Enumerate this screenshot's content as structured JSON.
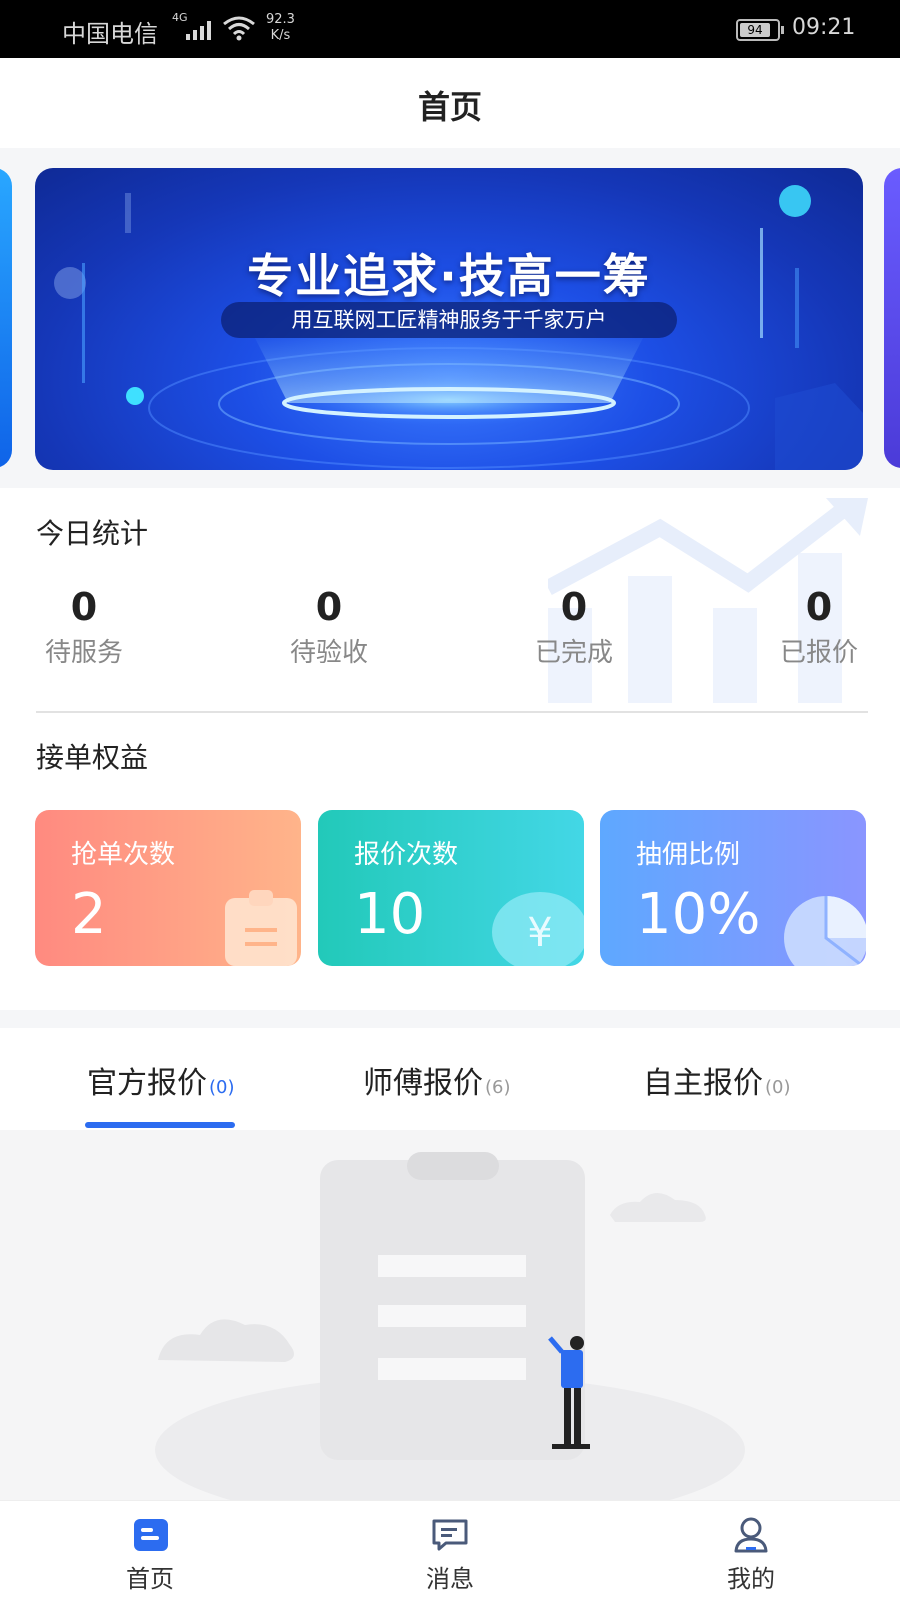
{
  "status_bar": {
    "carrier": "中国电信",
    "network": "4G",
    "speed_value": "92.3",
    "speed_unit": "K/s",
    "battery": "94",
    "time": "09:21"
  },
  "header": {
    "title": "首页"
  },
  "banner": {
    "title": "专业追求·技高一筹",
    "subtitle": "用互联网工匠精神服务于千家万户"
  },
  "today_stats": {
    "title": "今日统计",
    "items": [
      {
        "value": "0",
        "label": "待服务"
      },
      {
        "value": "0",
        "label": "待验收"
      },
      {
        "value": "0",
        "label": "已完成"
      },
      {
        "value": "0",
        "label": "已报价"
      }
    ]
  },
  "benefits": {
    "title": "接单权益",
    "items": [
      {
        "label": "抢单次数",
        "value": "2",
        "icon": "clipboard-icon",
        "colors": [
          "#ff8a80",
          "#ffb48a"
        ]
      },
      {
        "label": "报价次数",
        "value": "10",
        "icon": "yuan-coin-icon",
        "colors": [
          "#22c9b9",
          "#43d7e6"
        ]
      },
      {
        "label": "抽佣比例",
        "value": "10%",
        "icon": "pie-chart-icon",
        "colors": [
          "#5ea8ff",
          "#8a95ff"
        ]
      }
    ]
  },
  "tabs": [
    {
      "label": "官方报价",
      "count": "(0)",
      "active": true
    },
    {
      "label": "师傅报价",
      "count": "(6)",
      "active": false
    },
    {
      "label": "自主报价",
      "count": "(0)",
      "active": false
    }
  ],
  "bottom_nav": [
    {
      "label": "首页",
      "icon": "home-icon",
      "active": true
    },
    {
      "label": "消息",
      "icon": "message-icon",
      "active": false
    },
    {
      "label": "我的",
      "icon": "profile-icon",
      "active": false
    }
  ],
  "colors": {
    "accent": "#2c6cf0",
    "nav_icon": "#4a5a7a"
  }
}
